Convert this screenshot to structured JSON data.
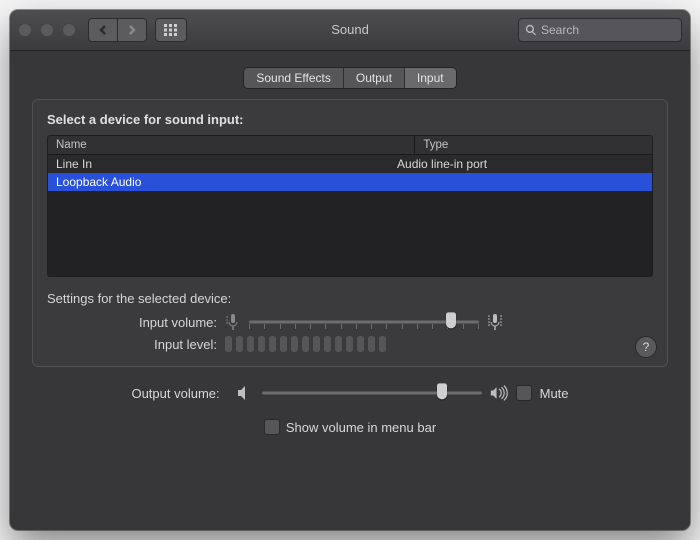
{
  "window": {
    "title": "Sound"
  },
  "toolbar": {
    "search_placeholder": "Search"
  },
  "tabs": [
    {
      "label": "Sound Effects",
      "active": false
    },
    {
      "label": "Output",
      "active": false
    },
    {
      "label": "Input",
      "active": true
    }
  ],
  "input_panel": {
    "heading": "Select a device for sound input:",
    "columns": {
      "name": "Name",
      "type": "Type"
    },
    "devices": [
      {
        "name": "Line In",
        "type": "Audio line-in port",
        "selected": false
      },
      {
        "name": "Loopback Audio",
        "type": "",
        "selected": true
      }
    ],
    "settings_heading": "Settings for the selected device:",
    "input_volume_label": "Input volume:",
    "input_volume_percent": 88,
    "input_level_label": "Input level:",
    "input_level_segments": 15
  },
  "output": {
    "label": "Output volume:",
    "volume_percent": 82,
    "mute_label": "Mute",
    "mute_checked": false,
    "menubar_label": "Show volume in menu bar",
    "menubar_checked": false
  },
  "icons": {
    "back": "chevron-left-icon",
    "forward": "chevron-right-icon",
    "grid": "grid-icon",
    "search": "search-icon",
    "mic_low": "microphone-low-icon",
    "mic_high": "microphone-high-icon",
    "speaker_low": "speaker-low-icon",
    "speaker_high": "speaker-high-icon",
    "help": "help-icon"
  }
}
